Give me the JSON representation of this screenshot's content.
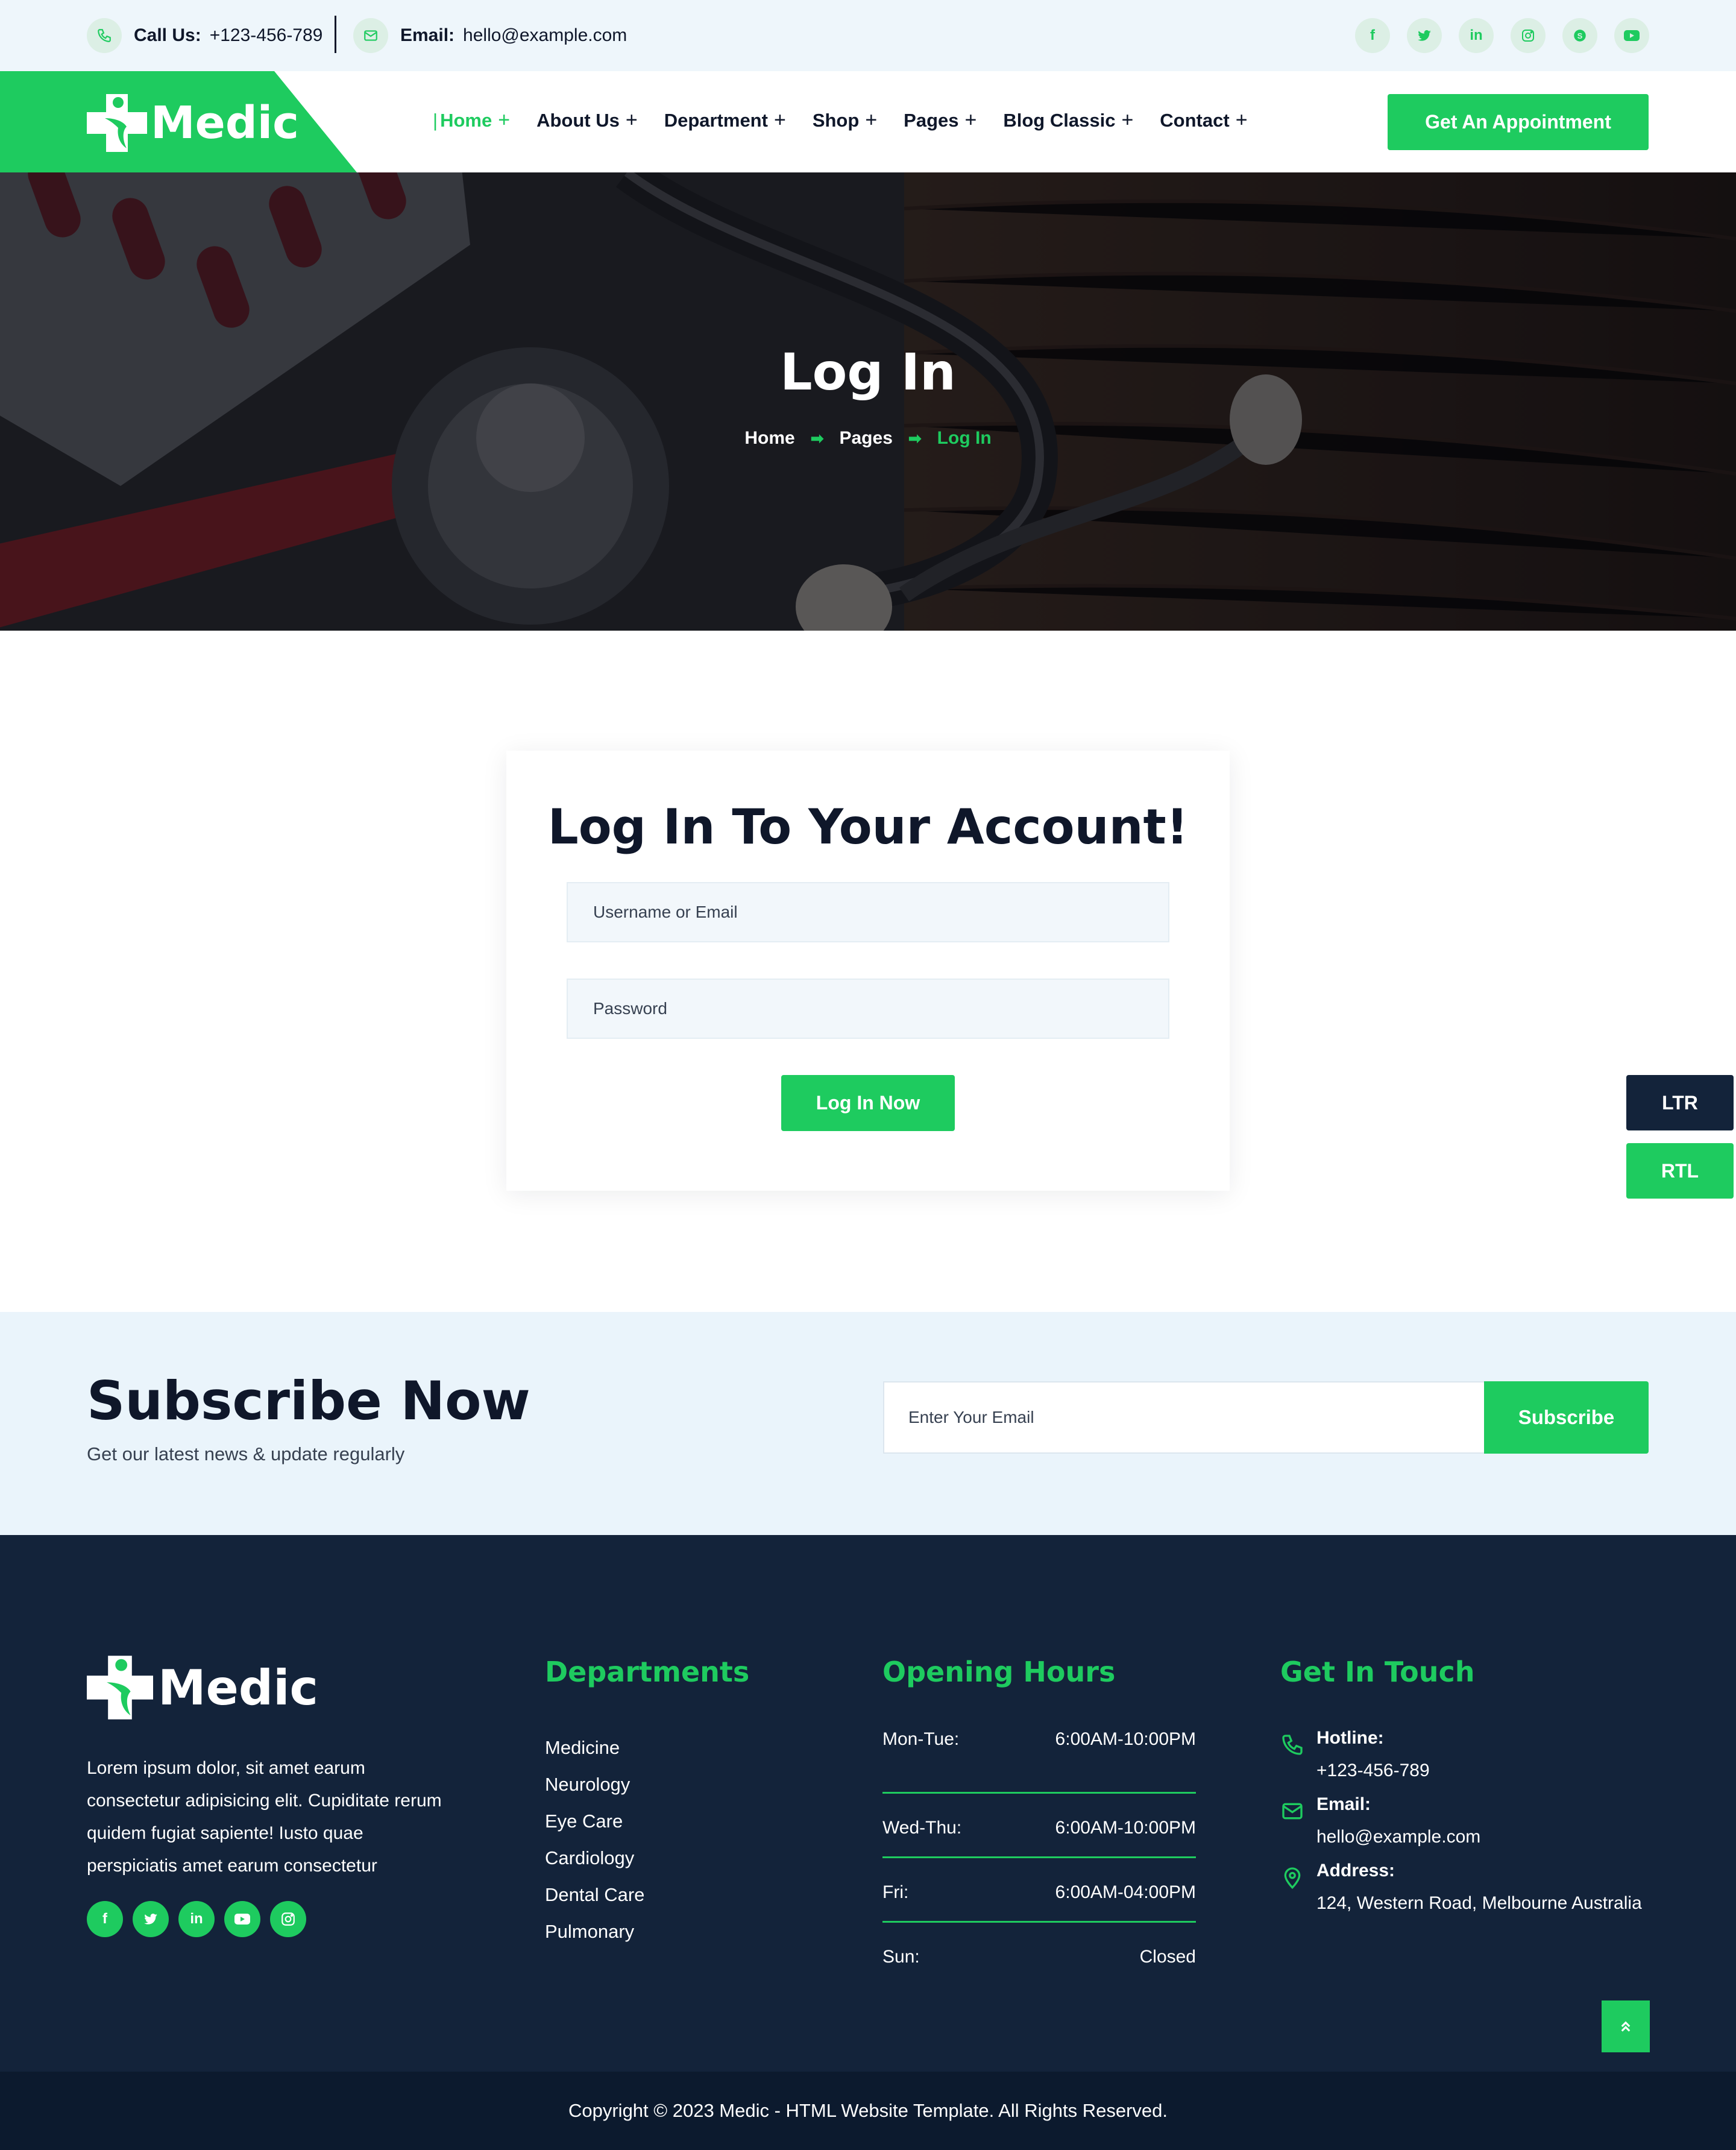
{
  "topbar": {
    "call_label": "Call Us:",
    "call_value": "+123-456-789",
    "email_label": "Email:",
    "email_value": "hello@example.com",
    "socials": [
      "facebook-icon",
      "twitter-icon",
      "linkedin-icon",
      "instagram-icon",
      "skype-icon",
      "youtube-icon"
    ]
  },
  "brand": {
    "name": "Medic",
    "accent": "#1ecb5f",
    "dark": "#13233a"
  },
  "nav": {
    "items": [
      {
        "label": "Home",
        "plus": "+"
      },
      {
        "label": "About Us",
        "plus": "+"
      },
      {
        "label": "Department",
        "plus": "+"
      },
      {
        "label": "Shop",
        "plus": "+"
      },
      {
        "label": "Pages",
        "plus": "+"
      },
      {
        "label": "Blog Classic",
        "plus": "+"
      },
      {
        "label": "Contact",
        "plus": "+"
      }
    ],
    "cta": "Get An Appointment"
  },
  "hero": {
    "title": "Log In",
    "breadcrumbs": [
      "Home",
      "Pages",
      "Log In"
    ]
  },
  "login": {
    "title": "Log In To Your Account!",
    "username_placeholder": "Username or Email",
    "password_placeholder": "Password",
    "button": "Log In Now"
  },
  "direction": {
    "ltr": "LTR",
    "rtl": "RTL"
  },
  "subscribe": {
    "title": "Subscribe Now",
    "text": "Get our latest news & update regularly",
    "placeholder": "Enter Your Email",
    "button": "Subscribe"
  },
  "footer": {
    "about": "Lorem ipsum dolor, sit amet earum consectetur adipisicing elit. Cupiditate rerum quidem fugiat sapiente! Iusto quae perspiciatis amet earum consectetur",
    "departments_title": "Departments",
    "departments": [
      "Medicine",
      "Neurology",
      "Eye Care",
      "Cardiology",
      "Dental Care",
      "Pulmonary"
    ],
    "hours_title": "Opening Hours",
    "hours": [
      {
        "day": "Mon-Tue:",
        "time": "6:00AM-10:00PM"
      },
      {
        "day": "Wed-Thu:",
        "time": "6:00AM-10:00PM"
      },
      {
        "day": "Fri:",
        "time": "6:00AM-04:00PM"
      },
      {
        "day": "Sun:",
        "time": "Closed"
      }
    ],
    "contact_title": "Get In Touch",
    "hotline_label": "Hotline:",
    "hotline": "+123-456-789",
    "email_label": "Email:",
    "email": "hello@example.com",
    "address_label": "Address:",
    "address": "124, Western Road, Melbourne Australia",
    "copyright": "Copyright © 2023 Medic - HTML Website Template. All Rights Reserved."
  }
}
